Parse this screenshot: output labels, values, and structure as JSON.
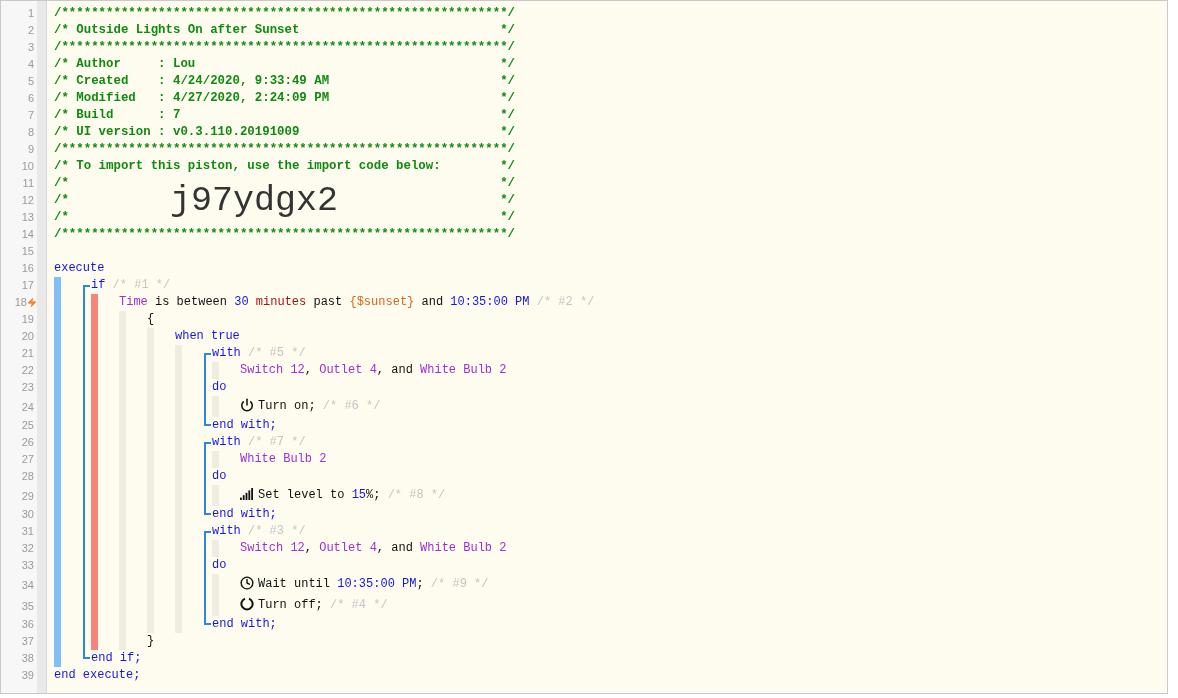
{
  "editor": {
    "header_lines": [
      {
        "line": "1",
        "kind": "banner",
        "text": "/************************************************************/"
      },
      {
        "line": "2",
        "kind": "comment",
        "text": "/* Outside Lights On after Sunset",
        "end": "*/"
      },
      {
        "line": "3",
        "kind": "banner",
        "text": "/************************************************************/"
      },
      {
        "line": "4",
        "kind": "comment",
        "text": "/* Author     : Lou",
        "end": "*/"
      },
      {
        "line": "5",
        "kind": "comment",
        "text": "/* Created    : 4/24/2020, 9:33:49 AM",
        "end": "*/"
      },
      {
        "line": "6",
        "kind": "comment",
        "text": "/* Modified   : 4/27/2020, 2:24:09 PM",
        "end": "*/"
      },
      {
        "line": "7",
        "kind": "comment",
        "text": "/* Build      : 7",
        "end": "*/"
      },
      {
        "line": "8",
        "kind": "comment",
        "text": "/* UI version : v0.3.110.20191009",
        "end": "*/"
      },
      {
        "line": "9",
        "kind": "banner",
        "text": "/************************************************************/"
      },
      {
        "line": "10",
        "kind": "comment",
        "text": "/* To import this piston, use the import code below:",
        "end": "*/"
      },
      {
        "line": "11",
        "kind": "comment",
        "text": "/*",
        "end": "*/"
      },
      {
        "line": "12",
        "kind": "code",
        "text": "/*",
        "code": "j97ydgx2",
        "end": "*/"
      },
      {
        "line": "13",
        "kind": "comment",
        "text": "/*",
        "end": "*/"
      },
      {
        "line": "14",
        "kind": "banner",
        "text": "/************************************************************/"
      },
      {
        "line": "15",
        "kind": "blank"
      }
    ],
    "program": {
      "kind": "execute",
      "line": "16",
      "keyword": "execute",
      "body": [
        {
          "kind": "if",
          "line": "17",
          "keyword": "if",
          "note": "/* #1 */",
          "conditions": [
            {
              "line": "18",
              "trigger": true,
              "segments": [
                {
                  "text": "Time",
                  "kind": "operand"
                },
                {
                  "text": " is between ",
                  "kind": "plain"
                },
                {
                  "text": "30",
                  "kind": "number"
                },
                {
                  "text": " minutes",
                  "kind": "unit"
                },
                {
                  "text": " past ",
                  "kind": "plain"
                },
                {
                  "text": "{$sunset}",
                  "kind": "variable"
                },
                {
                  "text": " and ",
                  "kind": "plain"
                },
                {
                  "text": "10:35:00 PM",
                  "kind": "number"
                },
                {
                  "text": " /* #2 */",
                  "kind": "faint"
                }
              ]
            }
          ],
          "then": {
            "kind": "braces",
            "open": {
              "line": "19",
              "text": "{"
            },
            "close": {
              "line": "37",
              "text": "}"
            },
            "body": [
              {
                "kind": "when",
                "line": "20",
                "keyword": "when true",
                "body": [
                  {
                    "kind": "with",
                    "line": "21",
                    "keyword": "with",
                    "note": "/* #5 */",
                    "devices": {
                      "line": "22",
                      "segments": [
                        {
                          "text": "Switch 12",
                          "kind": "operand"
                        },
                        {
                          "text": ", ",
                          "kind": "plain"
                        },
                        {
                          "text": "Outlet 4",
                          "kind": "operand"
                        },
                        {
                          "text": ", and ",
                          "kind": "plain"
                        },
                        {
                          "text": "White Bulb 2",
                          "kind": "operand"
                        }
                      ]
                    },
                    "do": {
                      "line": "23",
                      "keyword": "do"
                    },
                    "actions": [
                      {
                        "line": "24",
                        "kind": "power",
                        "segments": [
                          {
                            "text": "Turn on; ",
                            "kind": "plain"
                          },
                          {
                            "text": "/* #6 */",
                            "kind": "faint"
                          }
                        ]
                      }
                    ],
                    "end": {
                      "line": "25",
                      "keyword": "end with;"
                    }
                  },
                  {
                    "kind": "with",
                    "line": "26",
                    "keyword": "with",
                    "note": "/* #7 */",
                    "devices": {
                      "line": "27",
                      "segments": [
                        {
                          "text": "White Bulb 2",
                          "kind": "operand"
                        }
                      ]
                    },
                    "do": {
                      "line": "28",
                      "keyword": "do"
                    },
                    "actions": [
                      {
                        "line": "29",
                        "kind": "level",
                        "segments": [
                          {
                            "text": "Set level to ",
                            "kind": "plain"
                          },
                          {
                            "text": "15",
                            "kind": "number"
                          },
                          {
                            "text": "%; ",
                            "kind": "plain"
                          },
                          {
                            "text": "/* #8 */",
                            "kind": "faint"
                          }
                        ]
                      }
                    ],
                    "end": {
                      "line": "30",
                      "keyword": "end with;"
                    }
                  },
                  {
                    "kind": "with",
                    "line": "31",
                    "keyword": "with",
                    "note": "/* #3 */",
                    "devices": {
                      "line": "32",
                      "segments": [
                        {
                          "text": "Switch 12",
                          "kind": "operand"
                        },
                        {
                          "text": ", ",
                          "kind": "plain"
                        },
                        {
                          "text": "Outlet 4",
                          "kind": "operand"
                        },
                        {
                          "text": ", and ",
                          "kind": "plain"
                        },
                        {
                          "text": "White Bulb 2",
                          "kind": "operand"
                        }
                      ]
                    },
                    "do": {
                      "line": "33",
                      "keyword": "do"
                    },
                    "actions": [
                      {
                        "line": "34",
                        "kind": "wait",
                        "segments": [
                          {
                            "text": "Wait until ",
                            "kind": "plain"
                          },
                          {
                            "text": "10:35:00 PM",
                            "kind": "number"
                          },
                          {
                            "text": "; ",
                            "kind": "plain"
                          },
                          {
                            "text": "/* #9 */",
                            "kind": "faint"
                          }
                        ]
                      },
                      {
                        "line": "35",
                        "kind": "off",
                        "segments": [
                          {
                            "text": "Turn off; ",
                            "kind": "plain"
                          },
                          {
                            "text": "/* #4 */",
                            "kind": "faint"
                          }
                        ]
                      }
                    ],
                    "end": {
                      "line": "36",
                      "keyword": "end with;"
                    }
                  }
                ]
              }
            ]
          },
          "end": {
            "line": "38",
            "keyword": "end if;"
          }
        }
      ],
      "end": {
        "line": "39",
        "keyword": "end execute;"
      }
    }
  }
}
